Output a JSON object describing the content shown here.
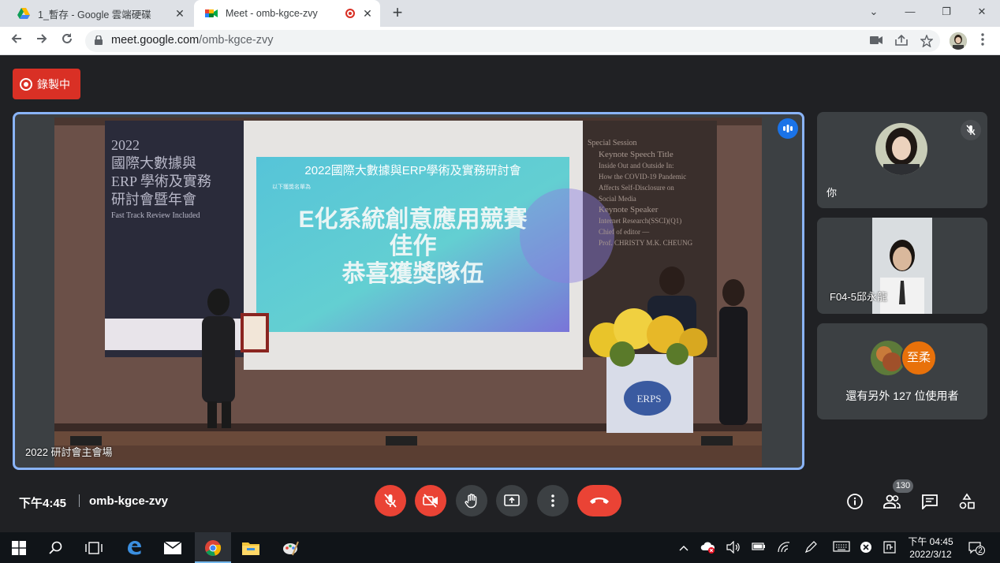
{
  "browser": {
    "tabs": [
      {
        "title": "1_暫存 - Google 雲端硬碟",
        "close": "✕"
      },
      {
        "title": "Meet - omb-kgce-zvy",
        "close": "✕"
      }
    ],
    "new_tab": "+",
    "window_buttons": [
      "⌄",
      "—",
      "❐",
      "✕"
    ],
    "url_host": "meet.google.com",
    "url_path": "/omb-kgce-zvy"
  },
  "meet": {
    "recording_label": "錄製中",
    "main_video": {
      "label": "2022 研討會主會場",
      "banner_left": [
        "2022",
        "國際大數據與",
        "ERP 學術及實務",
        "研討會暨年會",
        "Fast Track Review Included"
      ],
      "slide_title": "2022國際大數據與ERP學術及實務研討會",
      "slide_sub": "以下獲獎名單為",
      "slide_lines": [
        "E化系統創意應用競賽",
        "佳作",
        "恭喜獲獎隊伍"
      ],
      "banner_right": [
        "Special Session",
        "Keynote Speech Title",
        "Inside Out and Outside In:",
        "How the COVID-19 Pandemic",
        "Affects Self-Disclosure on",
        "Social Media",
        "Keynote Speaker",
        "Internet Research(SSCI)(Q1)",
        "Chief of editor —",
        "Prof. CHRISTY M.K. CHEUNG"
      ],
      "podium_logo": "ERPS"
    },
    "tiles": [
      {
        "name": "你"
      },
      {
        "name": "F04-5邱永龍"
      },
      {
        "avatar_letter": "至柔",
        "more_text": "還有另外 127 位使用者"
      }
    ],
    "bottom": {
      "time": "下午4:45",
      "meeting_code": "omb-kgce-zvy",
      "participant_count": "130"
    },
    "colors": {
      "danger": "#ea4335",
      "accent": "#8ab4f8",
      "avatar_orange": "#e8710a"
    }
  },
  "taskbar": {
    "clock_time": "下午 04:45",
    "clock_date": "2022/3/12",
    "notif_count": "2"
  }
}
